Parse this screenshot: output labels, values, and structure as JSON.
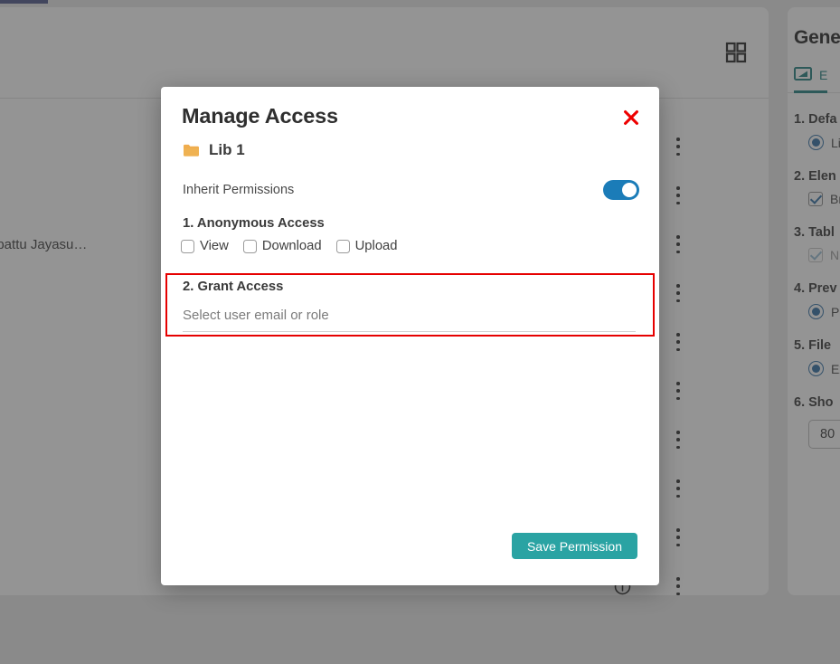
{
  "background": {
    "grid_view_icon": "grid-view-icon",
    "rows": [
      {
        "name": "",
        "info_icon": "info-icon",
        "menu_icon": "kebab-menu-icon"
      },
      {
        "name": "",
        "info_icon": "info-icon",
        "menu_icon": "kebab-menu-icon"
      },
      {
        "name": "apattu Jayasu…",
        "info_icon": "info-icon",
        "menu_icon": "kebab-menu-icon"
      },
      {
        "name": "",
        "info_icon": "info-icon",
        "menu_icon": "kebab-menu-icon"
      },
      {
        "name": "",
        "info_icon": "info-icon",
        "menu_icon": "kebab-menu-icon"
      },
      {
        "name": "",
        "info_icon": "info-icon",
        "menu_icon": "kebab-menu-icon"
      },
      {
        "name": "",
        "info_icon": "info-icon",
        "menu_icon": "kebab-menu-icon"
      },
      {
        "name": "",
        "info_icon": "info-icon",
        "menu_icon": "kebab-menu-icon"
      },
      {
        "name": "",
        "info_icon": "info-icon",
        "menu_icon": "kebab-menu-icon"
      },
      {
        "name": "",
        "info_icon": "info-icon",
        "menu_icon": "kebab-menu-icon"
      }
    ]
  },
  "right_panel": {
    "title": "Gene",
    "tab": {
      "label": "E",
      "icon": "monitor-icon"
    },
    "sections": [
      {
        "title": "1. Defa",
        "control": "radio",
        "checked": true,
        "label": "Lis"
      },
      {
        "title": "2. Elen",
        "control": "checkbox",
        "checked": true,
        "label": "Br"
      },
      {
        "title": "3. Tabl",
        "control": "checkbox",
        "checked": true,
        "faded": true,
        "label": "N"
      },
      {
        "title": "4. Prev",
        "control": "radio",
        "checked": true,
        "label": "Po"
      },
      {
        "title": "5. File",
        "control": "radio",
        "checked": true,
        "label": "Ex"
      },
      {
        "title": "6. Sho",
        "control": "number",
        "value": "80"
      }
    ]
  },
  "modal": {
    "title": "Manage Access",
    "close_icon": "close-icon",
    "folder": {
      "icon": "folder-icon",
      "name": "Lib 1"
    },
    "inherit": {
      "label": "Inherit Permissions",
      "toggle_on": true
    },
    "anonymous_access": {
      "heading": "1. Anonymous Access",
      "checkboxes": [
        {
          "label": "View",
          "checked": false
        },
        {
          "label": "Download",
          "checked": false
        },
        {
          "label": "Upload",
          "checked": false
        }
      ]
    },
    "grant_access": {
      "heading": "2. Grant Access",
      "select_placeholder": "Select user email or role",
      "select_value": ""
    },
    "save_label": "Save Permission"
  },
  "colors": {
    "accent_teal": "#2aa3a3",
    "toggle_blue": "#1b7cb8",
    "close_red": "#e60000",
    "annotation_red": "#e60000",
    "folder_amber": "#efab3d",
    "tab_teal": "#1c7d7d",
    "radio_blue": "#2b6ca3",
    "top_accent": "#4a5387"
  }
}
